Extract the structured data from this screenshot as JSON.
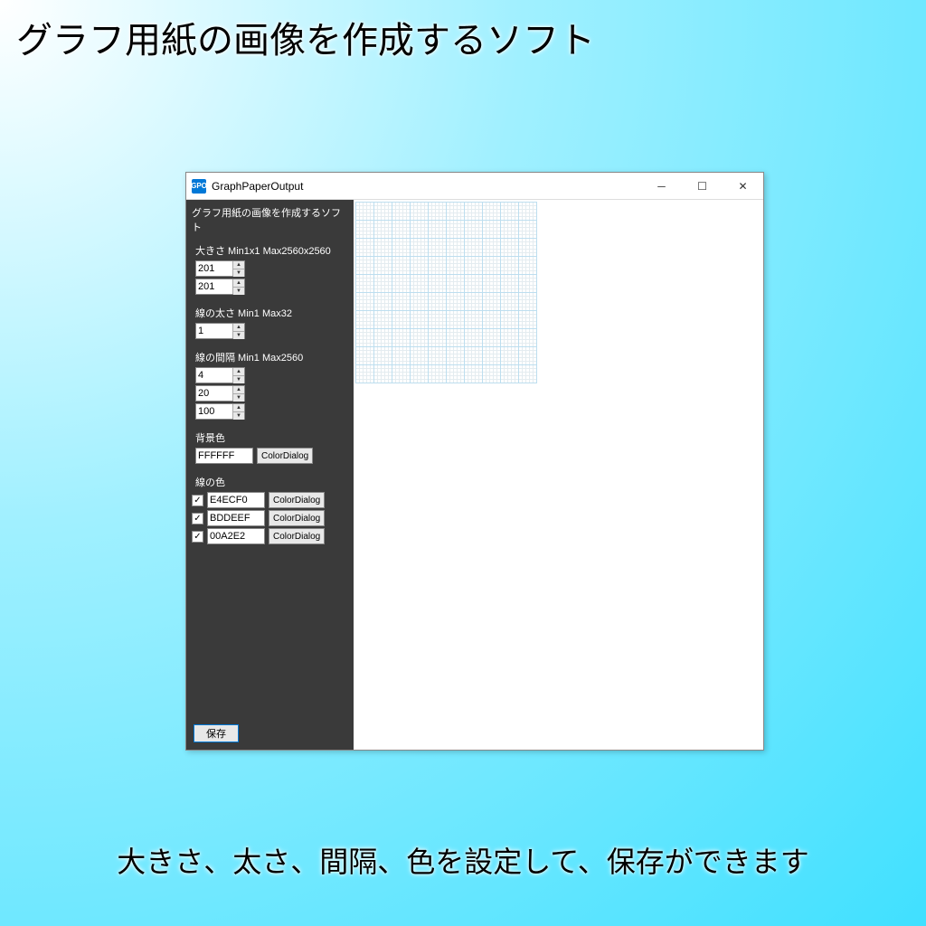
{
  "page": {
    "title": "グラフ用紙の画像を作成するソフト",
    "footer": "大きさ、太さ、間隔、色を設定して、保存ができます"
  },
  "window": {
    "title": "GraphPaperOutput",
    "icon_text": "GPO"
  },
  "sidebar": {
    "heading": "グラフ用紙の画像を作成するソフト",
    "size": {
      "label": "大きさ  Min1x1 Max2560x2560",
      "width": "201",
      "height": "201"
    },
    "thickness": {
      "label": "線の太さ  Min1 Max32",
      "value": "1"
    },
    "spacing": {
      "label": "線の間隔  Min1 Max2560",
      "v1": "4",
      "v2": "20",
      "v3": "100"
    },
    "bgcolor": {
      "label": "背景色",
      "value": "FFFFFF",
      "dialog": "ColorDialog"
    },
    "linecolor": {
      "label": "線の色",
      "rows": [
        {
          "checked": true,
          "value": "E4ECF0",
          "dialog": "ColorDialog"
        },
        {
          "checked": true,
          "value": "BDDEEF",
          "dialog": "ColorDialog"
        },
        {
          "checked": true,
          "value": "00A2E2",
          "dialog": "ColorDialog"
        }
      ]
    },
    "save": "保存"
  }
}
